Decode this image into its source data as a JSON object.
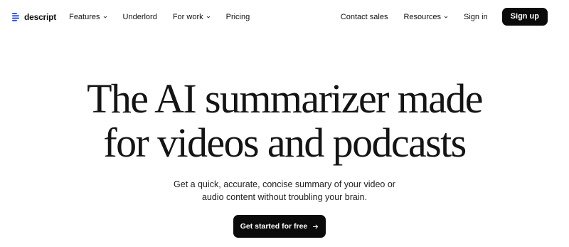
{
  "nav": {
    "logo_text": "descript",
    "left_items": [
      {
        "label": "Features",
        "dropdown": true
      },
      {
        "label": "Underlord",
        "dropdown": false
      },
      {
        "label": "For work",
        "dropdown": true
      },
      {
        "label": "Pricing",
        "dropdown": false
      }
    ],
    "right_items": [
      {
        "label": "Contact sales",
        "dropdown": false
      },
      {
        "label": "Resources",
        "dropdown": true
      },
      {
        "label": "Sign in",
        "dropdown": false
      }
    ],
    "signup_label": "Sign up"
  },
  "hero": {
    "title_line1": "The AI summarizer made",
    "title_line2": "for videos and podcasts",
    "subtitle_line1": "Get a quick, accurate, concise summary of your video or",
    "subtitle_line2": "audio content without troubling your brain.",
    "cta_label": "Get started for free"
  },
  "icons": {
    "logo": "descript-logo-icon",
    "dropdown": "chevron-down-icon",
    "cta": "arrow-right-icon"
  },
  "colors": {
    "background": "#ffffff",
    "text": "#111111",
    "button_bg": "#0b0b0b",
    "button_text": "#ffffff",
    "logo_accent": "#2f54eb"
  }
}
